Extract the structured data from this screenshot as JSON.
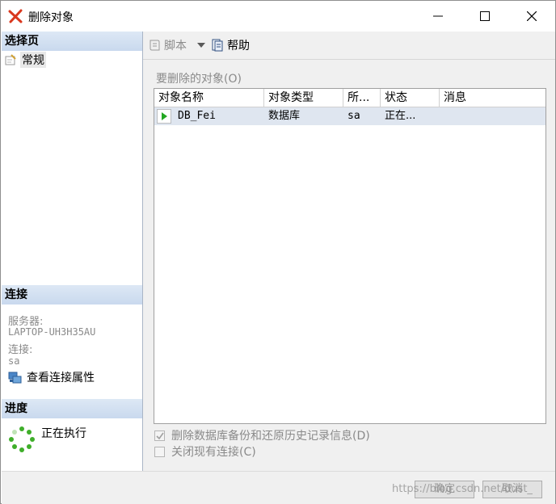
{
  "window": {
    "title": "删除对象"
  },
  "left": {
    "select_page_header": "选择页",
    "pages": [
      {
        "label": "常规"
      }
    ],
    "connection_header": "连接",
    "server_label": "服务器:",
    "server_value": "LAPTOP-UH3H35AU",
    "connection_label": "连接:",
    "connection_value": "sa",
    "view_props_link": "查看连接属性",
    "progress_header": "进度",
    "progress_status": "正在执行"
  },
  "toolbar": {
    "script_label": "脚本",
    "help_label": "帮助"
  },
  "objects": {
    "label": "要删除的对象(O)",
    "columns": [
      "对象名称",
      "对象类型",
      "所...",
      "状态",
      "消息"
    ],
    "rows": [
      {
        "name": "DB_Fei",
        "type": "数据库",
        "owner": "sa",
        "status": "正在...",
        "message": ""
      }
    ]
  },
  "options": {
    "delete_backup": {
      "label": "删除数据库备份和还原历史记录信息(D)",
      "checked": true
    },
    "close_connections": {
      "label": "关闭现有连接(C)",
      "checked": false
    }
  },
  "buttons": {
    "ok": "确定",
    "cancel": "取消"
  },
  "watermark": "https://blog.csdn.net/dust_"
}
